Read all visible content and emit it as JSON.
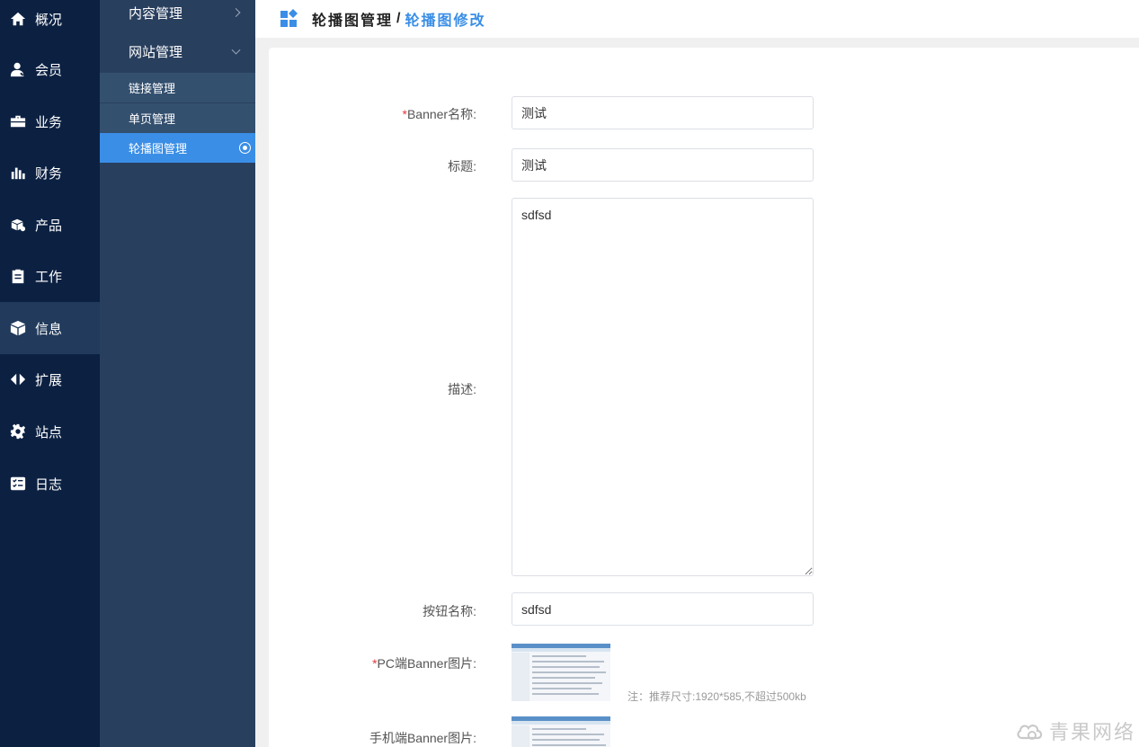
{
  "primary_nav": [
    {
      "label": "概况",
      "icon": "home-icon"
    },
    {
      "label": "会员",
      "icon": "user-icon"
    },
    {
      "label": "业务",
      "icon": "briefcase-icon"
    },
    {
      "label": "财务",
      "icon": "bar-chart-icon"
    },
    {
      "label": "产品",
      "icon": "box-icon"
    },
    {
      "label": "工作",
      "icon": "clipboard-icon"
    },
    {
      "label": "信息",
      "icon": "cube-icon",
      "active": true
    },
    {
      "label": "扩展",
      "icon": "arrows-icon"
    },
    {
      "label": "站点",
      "icon": "gear-icon"
    },
    {
      "label": "日志",
      "icon": "checklist-icon"
    }
  ],
  "secondary_nav": {
    "groups": [
      {
        "label": "内容管理",
        "expanded": false
      },
      {
        "label": "网站管理",
        "expanded": true
      }
    ],
    "sub_items": [
      {
        "label": "链接管理"
      },
      {
        "label": "单页管理"
      },
      {
        "label": "轮播图管理",
        "active": true
      }
    ]
  },
  "header": {
    "crumb_parent": "轮播图管理",
    "separator": "/",
    "crumb_current": "轮播图修改"
  },
  "form": {
    "banner_name": {
      "required_mark": "*",
      "label": "Banner名称:",
      "value": "测试"
    },
    "title": {
      "label": "标题:",
      "value": "测试"
    },
    "description": {
      "label": "描述:",
      "value": "sdfsd"
    },
    "button_name": {
      "label": "按钮名称:",
      "value": "sdfsd"
    },
    "pc_image": {
      "required_mark": "*",
      "label": "PC端Banner图片:",
      "note": "注：推荐尺寸:1920*585,不超过500kb"
    },
    "mobile_image": {
      "label": "手机端Banner图片:"
    }
  },
  "watermark": {
    "text": "青果网络"
  },
  "colors": {
    "accent": "#3a8ee6",
    "sidebar_primary": "#0c2142",
    "sidebar_secondary": "#293f5e",
    "required": "#e4393c"
  }
}
